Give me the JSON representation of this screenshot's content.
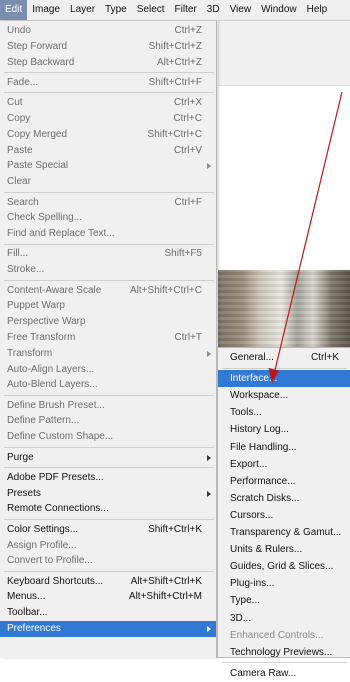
{
  "menubar": [
    "Edit",
    "Image",
    "Layer",
    "Type",
    "Select",
    "Filter",
    "3D",
    "View",
    "Window",
    "Help"
  ],
  "edit_menu": [
    {
      "label": "Undo",
      "shortcut": "Ctrl+Z",
      "enabled": false
    },
    {
      "label": "Step Forward",
      "shortcut": "Shift+Ctrl+Z",
      "enabled": false
    },
    {
      "label": "Step Backward",
      "shortcut": "Alt+Ctrl+Z",
      "enabled": false
    },
    {
      "sep": true
    },
    {
      "label": "Fade...",
      "shortcut": "Shift+Ctrl+F",
      "enabled": false
    },
    {
      "sep": true
    },
    {
      "label": "Cut",
      "shortcut": "Ctrl+X",
      "enabled": false
    },
    {
      "label": "Copy",
      "shortcut": "Ctrl+C",
      "enabled": false
    },
    {
      "label": "Copy Merged",
      "shortcut": "Shift+Ctrl+C",
      "enabled": false
    },
    {
      "label": "Paste",
      "shortcut": "Ctrl+V",
      "enabled": false
    },
    {
      "label": "Paste Special",
      "shortcut": "",
      "enabled": false,
      "submenu": true
    },
    {
      "label": "Clear",
      "shortcut": "",
      "enabled": false
    },
    {
      "sep": true
    },
    {
      "label": "Search",
      "shortcut": "Ctrl+F",
      "enabled": false
    },
    {
      "label": "Check Spelling...",
      "shortcut": "",
      "enabled": false
    },
    {
      "label": "Find and Replace Text...",
      "shortcut": "",
      "enabled": false
    },
    {
      "sep": true
    },
    {
      "label": "Fill...",
      "shortcut": "Shift+F5",
      "enabled": false
    },
    {
      "label": "Stroke...",
      "shortcut": "",
      "enabled": false
    },
    {
      "sep": true
    },
    {
      "label": "Content-Aware Scale",
      "shortcut": "Alt+Shift+Ctrl+C",
      "enabled": false
    },
    {
      "label": "Puppet Warp",
      "shortcut": "",
      "enabled": false
    },
    {
      "label": "Perspective Warp",
      "shortcut": "",
      "enabled": false
    },
    {
      "label": "Free Transform",
      "shortcut": "Ctrl+T",
      "enabled": false
    },
    {
      "label": "Transform",
      "shortcut": "",
      "enabled": false,
      "submenu": true
    },
    {
      "label": "Auto-Align Layers...",
      "shortcut": "",
      "enabled": false
    },
    {
      "label": "Auto-Blend Layers...",
      "shortcut": "",
      "enabled": false
    },
    {
      "sep": true
    },
    {
      "label": "Define Brush Preset...",
      "shortcut": "",
      "enabled": false
    },
    {
      "label": "Define Pattern...",
      "shortcut": "",
      "enabled": false
    },
    {
      "label": "Define Custom Shape...",
      "shortcut": "",
      "enabled": false
    },
    {
      "sep": true
    },
    {
      "label": "Purge",
      "shortcut": "",
      "enabled": true,
      "submenu": true
    },
    {
      "sep": true
    },
    {
      "label": "Adobe PDF Presets...",
      "shortcut": "",
      "enabled": true
    },
    {
      "label": "Presets",
      "shortcut": "",
      "enabled": true,
      "submenu": true
    },
    {
      "label": "Remote Connections...",
      "shortcut": "",
      "enabled": true
    },
    {
      "sep": true
    },
    {
      "label": "Color Settings...",
      "shortcut": "Shift+Ctrl+K",
      "enabled": true
    },
    {
      "label": "Assign Profile...",
      "shortcut": "",
      "enabled": false
    },
    {
      "label": "Convert to Profile...",
      "shortcut": "",
      "enabled": false
    },
    {
      "sep": true
    },
    {
      "label": "Keyboard Shortcuts...",
      "shortcut": "Alt+Shift+Ctrl+K",
      "enabled": true
    },
    {
      "label": "Menus...",
      "shortcut": "Alt+Shift+Ctrl+M",
      "enabled": true
    },
    {
      "label": "Toolbar...",
      "shortcut": "",
      "enabled": true
    },
    {
      "label": "Preferences",
      "shortcut": "",
      "enabled": true,
      "submenu": true,
      "highlighted": true
    }
  ],
  "preferences_menu": [
    {
      "label": "General...",
      "shortcut": "Ctrl+K"
    },
    {
      "sep": true
    },
    {
      "label": "Interface...",
      "shortcut": "",
      "highlighted": true
    },
    {
      "label": "Workspace...",
      "shortcut": ""
    },
    {
      "label": "Tools...",
      "shortcut": ""
    },
    {
      "label": "History Log...",
      "shortcut": ""
    },
    {
      "label": "File Handling...",
      "shortcut": ""
    },
    {
      "label": "Export...",
      "shortcut": ""
    },
    {
      "label": "Performance...",
      "shortcut": ""
    },
    {
      "label": "Scratch Disks...",
      "shortcut": ""
    },
    {
      "label": "Cursors...",
      "shortcut": ""
    },
    {
      "label": "Transparency & Gamut...",
      "shortcut": ""
    },
    {
      "label": "Units & Rulers...",
      "shortcut": ""
    },
    {
      "label": "Guides, Grid & Slices...",
      "shortcut": ""
    },
    {
      "label": "Plug-ins...",
      "shortcut": ""
    },
    {
      "label": "Type...",
      "shortcut": ""
    },
    {
      "label": "3D...",
      "shortcut": ""
    },
    {
      "label": "Enhanced Controls...",
      "shortcut": "",
      "disabled": true
    },
    {
      "label": "Technology Previews...",
      "shortcut": ""
    },
    {
      "sep": true
    },
    {
      "label": "Camera Raw...",
      "shortcut": ""
    }
  ],
  "colors": {
    "highlight": "#3279d6",
    "arrow": "#c0171b",
    "menu_bg": "#f0f0f0"
  }
}
